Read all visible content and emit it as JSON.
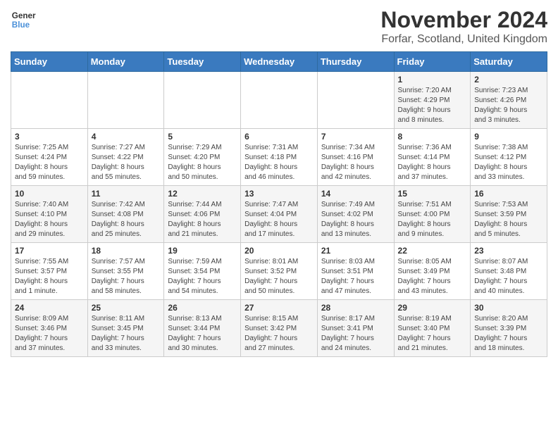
{
  "header": {
    "logo_line1": "General",
    "logo_line2": "Blue",
    "month_title": "November 2024",
    "subtitle": "Forfar, Scotland, United Kingdom"
  },
  "days_of_week": [
    "Sunday",
    "Monday",
    "Tuesday",
    "Wednesday",
    "Thursday",
    "Friday",
    "Saturday"
  ],
  "weeks": [
    [
      {
        "day": "",
        "info": ""
      },
      {
        "day": "",
        "info": ""
      },
      {
        "day": "",
        "info": ""
      },
      {
        "day": "",
        "info": ""
      },
      {
        "day": "",
        "info": ""
      },
      {
        "day": "1",
        "info": "Sunrise: 7:20 AM\nSunset: 4:29 PM\nDaylight: 9 hours\nand 8 minutes."
      },
      {
        "day": "2",
        "info": "Sunrise: 7:23 AM\nSunset: 4:26 PM\nDaylight: 9 hours\nand 3 minutes."
      }
    ],
    [
      {
        "day": "3",
        "info": "Sunrise: 7:25 AM\nSunset: 4:24 PM\nDaylight: 8 hours\nand 59 minutes."
      },
      {
        "day": "4",
        "info": "Sunrise: 7:27 AM\nSunset: 4:22 PM\nDaylight: 8 hours\nand 55 minutes."
      },
      {
        "day": "5",
        "info": "Sunrise: 7:29 AM\nSunset: 4:20 PM\nDaylight: 8 hours\nand 50 minutes."
      },
      {
        "day": "6",
        "info": "Sunrise: 7:31 AM\nSunset: 4:18 PM\nDaylight: 8 hours\nand 46 minutes."
      },
      {
        "day": "7",
        "info": "Sunrise: 7:34 AM\nSunset: 4:16 PM\nDaylight: 8 hours\nand 42 minutes."
      },
      {
        "day": "8",
        "info": "Sunrise: 7:36 AM\nSunset: 4:14 PM\nDaylight: 8 hours\nand 37 minutes."
      },
      {
        "day": "9",
        "info": "Sunrise: 7:38 AM\nSunset: 4:12 PM\nDaylight: 8 hours\nand 33 minutes."
      }
    ],
    [
      {
        "day": "10",
        "info": "Sunrise: 7:40 AM\nSunset: 4:10 PM\nDaylight: 8 hours\nand 29 minutes."
      },
      {
        "day": "11",
        "info": "Sunrise: 7:42 AM\nSunset: 4:08 PM\nDaylight: 8 hours\nand 25 minutes."
      },
      {
        "day": "12",
        "info": "Sunrise: 7:44 AM\nSunset: 4:06 PM\nDaylight: 8 hours\nand 21 minutes."
      },
      {
        "day": "13",
        "info": "Sunrise: 7:47 AM\nSunset: 4:04 PM\nDaylight: 8 hours\nand 17 minutes."
      },
      {
        "day": "14",
        "info": "Sunrise: 7:49 AM\nSunset: 4:02 PM\nDaylight: 8 hours\nand 13 minutes."
      },
      {
        "day": "15",
        "info": "Sunrise: 7:51 AM\nSunset: 4:00 PM\nDaylight: 8 hours\nand 9 minutes."
      },
      {
        "day": "16",
        "info": "Sunrise: 7:53 AM\nSunset: 3:59 PM\nDaylight: 8 hours\nand 5 minutes."
      }
    ],
    [
      {
        "day": "17",
        "info": "Sunrise: 7:55 AM\nSunset: 3:57 PM\nDaylight: 8 hours\nand 1 minute."
      },
      {
        "day": "18",
        "info": "Sunrise: 7:57 AM\nSunset: 3:55 PM\nDaylight: 7 hours\nand 58 minutes."
      },
      {
        "day": "19",
        "info": "Sunrise: 7:59 AM\nSunset: 3:54 PM\nDaylight: 7 hours\nand 54 minutes."
      },
      {
        "day": "20",
        "info": "Sunrise: 8:01 AM\nSunset: 3:52 PM\nDaylight: 7 hours\nand 50 minutes."
      },
      {
        "day": "21",
        "info": "Sunrise: 8:03 AM\nSunset: 3:51 PM\nDaylight: 7 hours\nand 47 minutes."
      },
      {
        "day": "22",
        "info": "Sunrise: 8:05 AM\nSunset: 3:49 PM\nDaylight: 7 hours\nand 43 minutes."
      },
      {
        "day": "23",
        "info": "Sunrise: 8:07 AM\nSunset: 3:48 PM\nDaylight: 7 hours\nand 40 minutes."
      }
    ],
    [
      {
        "day": "24",
        "info": "Sunrise: 8:09 AM\nSunset: 3:46 PM\nDaylight: 7 hours\nand 37 minutes."
      },
      {
        "day": "25",
        "info": "Sunrise: 8:11 AM\nSunset: 3:45 PM\nDaylight: 7 hours\nand 33 minutes."
      },
      {
        "day": "26",
        "info": "Sunrise: 8:13 AM\nSunset: 3:44 PM\nDaylight: 7 hours\nand 30 minutes."
      },
      {
        "day": "27",
        "info": "Sunrise: 8:15 AM\nSunset: 3:42 PM\nDaylight: 7 hours\nand 27 minutes."
      },
      {
        "day": "28",
        "info": "Sunrise: 8:17 AM\nSunset: 3:41 PM\nDaylight: 7 hours\nand 24 minutes."
      },
      {
        "day": "29",
        "info": "Sunrise: 8:19 AM\nSunset: 3:40 PM\nDaylight: 7 hours\nand 21 minutes."
      },
      {
        "day": "30",
        "info": "Sunrise: 8:20 AM\nSunset: 3:39 PM\nDaylight: 7 hours\nand 18 minutes."
      }
    ]
  ]
}
